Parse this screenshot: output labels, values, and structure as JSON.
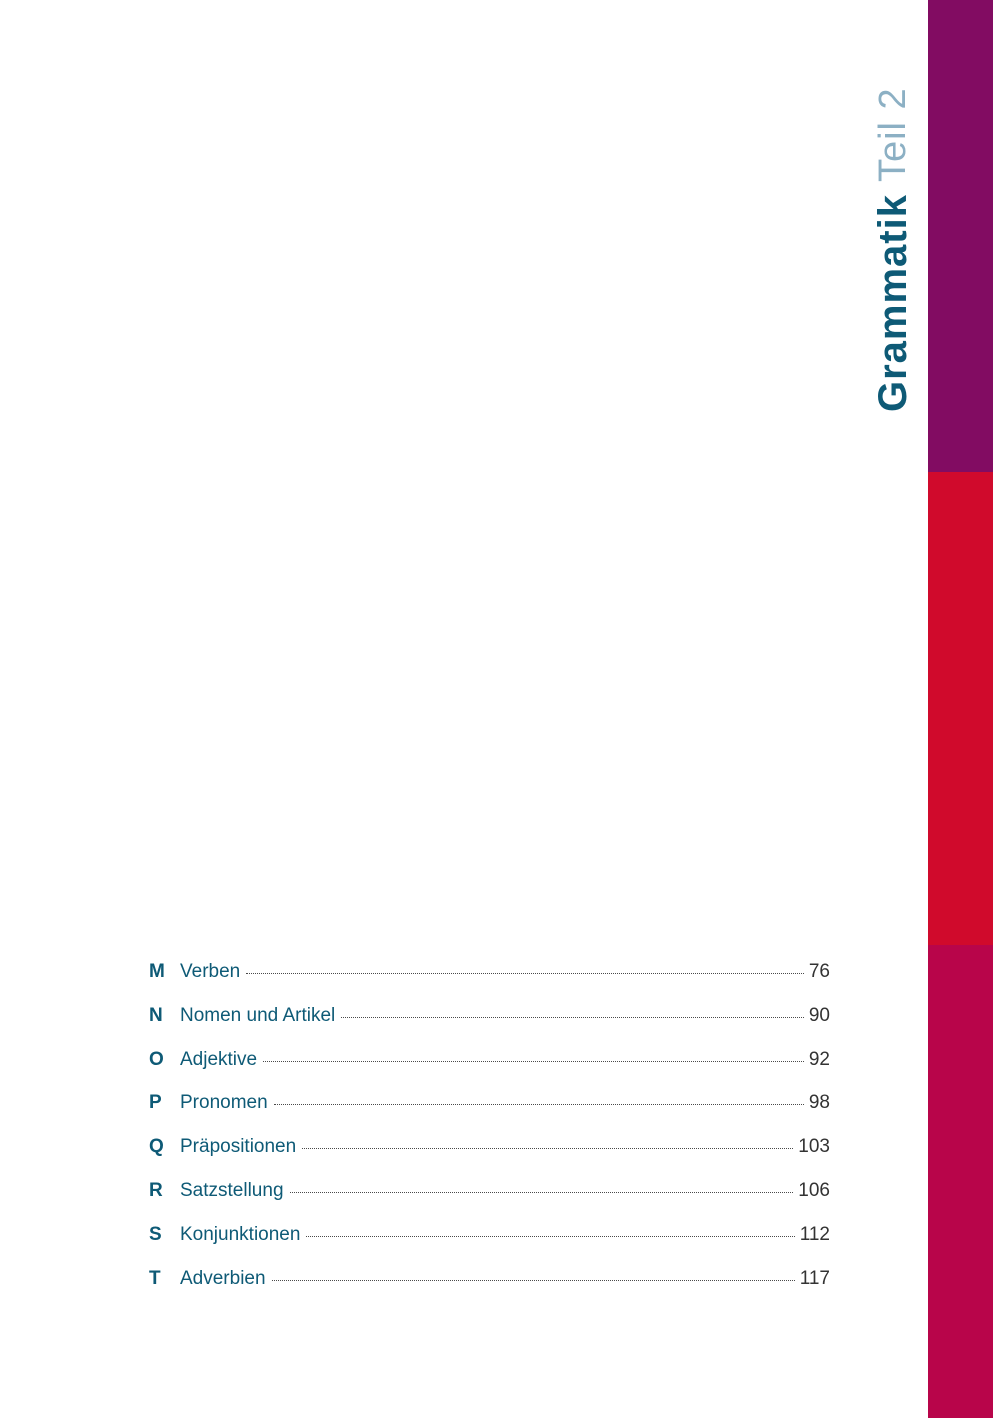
{
  "colors": {
    "bar_top": "#820c62",
    "bar_middle": "#d00a2c",
    "bar_bottom": "#b8054a",
    "title_bold": "#0e5a76",
    "title_light": "#8cb0c4",
    "toc_text": "#0e5a76",
    "page_number": "#333333"
  },
  "chapter": {
    "part": "Teil 2",
    "name": "Grammatik"
  },
  "toc": [
    {
      "letter": "M",
      "title": "Verben",
      "page": "76"
    },
    {
      "letter": "N",
      "title": "Nomen und Artikel",
      "page": "90"
    },
    {
      "letter": "O",
      "title": "Adjektive",
      "page": "92"
    },
    {
      "letter": "P",
      "title": "Pronomen",
      "page": "98"
    },
    {
      "letter": "Q",
      "title": "Präpositionen",
      "page": "103"
    },
    {
      "letter": "R",
      "title": "Satzstellung",
      "page": "106"
    },
    {
      "letter": "S",
      "title": "Konjunktionen",
      "page": "112"
    },
    {
      "letter": "T",
      "title": "Adverbien",
      "page": "117"
    }
  ]
}
